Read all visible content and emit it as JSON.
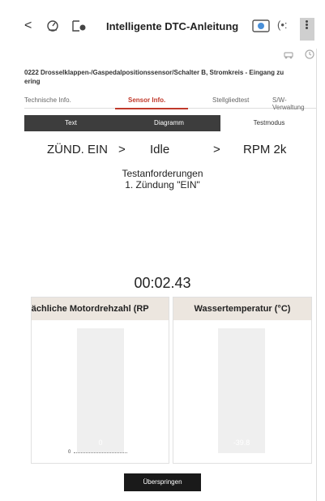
{
  "header": {
    "back_label": "<",
    "title": "Intelligente DTC-Anleitung",
    "icons": [
      "back-icon",
      "gauge-icon",
      "record-icon",
      "camera-icon",
      "signal-icon",
      "more-icon",
      "vehicle-icon",
      "refresh-icon"
    ]
  },
  "dtc": {
    "description": "0222 Drosselklappen-/Gaspedalpositionssensor/Schalter B, Stromkreis - Eingang zu\nering"
  },
  "tabs": [
    {
      "label": "Technische Info.",
      "active": false
    },
    {
      "label": "Sensor Info.",
      "active": true
    },
    {
      "label": "Stellgliedtest",
      "active": false
    },
    {
      "label": "S/W-Verwaltung",
      "active": false
    }
  ],
  "subtabs": [
    {
      "label": "Text",
      "active": true
    },
    {
      "label": "Diagramm",
      "active": true
    },
    {
      "label": "Testmodus",
      "active": false
    }
  ],
  "sequence": {
    "step1": "ZÜND. EIN",
    "arrow1": ">",
    "step2": "Idle",
    "arrow2": ">",
    "step3": "RPM 2k"
  },
  "test_request": {
    "title": "Testanforderungen",
    "line1": "1. Zündung \"EIN\""
  },
  "timer": "00:02.43",
  "panels": [
    {
      "title": "tsächliche Motordrehzahl (RP",
      "value": "0",
      "level": 0
    },
    {
      "title": "Wassertemperatur (°C)",
      "value": "-39.8",
      "level": 0
    }
  ],
  "axis_zero": "0",
  "skip_button": "Überspringen",
  "colors": {
    "accent": "#c0392b",
    "dark": "#3d3d3d",
    "panel_header": "#ece6df"
  }
}
